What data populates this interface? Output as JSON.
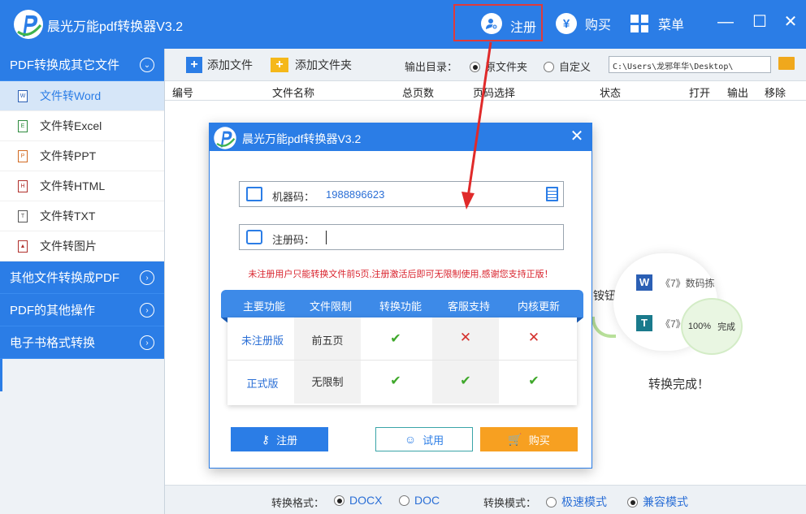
{
  "app": {
    "title": "晨光万能pdf转换器V3.2",
    "accent_color": "#2b7de6"
  },
  "titlebar": {
    "register_label": "注册",
    "register_icon": "user-add-icon",
    "buy_label": "购买",
    "buy_icon": "yen-icon",
    "menu_label": "菜单",
    "menu_icon": "grid-menu-icon",
    "minimize": "—",
    "maximize": "☐",
    "close": "✕"
  },
  "sidebar": {
    "group_main": "PDF转换成其它文件",
    "items": [
      {
        "label": "文件转Word",
        "icon": "W",
        "active": true
      },
      {
        "label": "文件转Excel",
        "icon": "E"
      },
      {
        "label": "文件转PPT",
        "icon": "P"
      },
      {
        "label": "文件转HTML",
        "icon": "H"
      },
      {
        "label": "文件转TXT",
        "icon": "T"
      },
      {
        "label": "文件转图片",
        "icon": "▲"
      }
    ],
    "groups": [
      {
        "label": "其他文件转换成PDF"
      },
      {
        "label": "PDF的其他操作"
      },
      {
        "label": "电子书格式转换"
      }
    ]
  },
  "toolbar": {
    "add_file": "添加文件",
    "add_folder": "添加文件夹",
    "output_dir_label": "输出目录：",
    "opt_source": "原文件夹",
    "opt_custom": "自定义",
    "output_path": "C:\\Users\\龙邪年华\\Desktop\\"
  },
  "table": {
    "headers": [
      "编号",
      "文件名称",
      "总页数",
      "页码选择",
      "状态",
      "打开",
      "输出",
      "移除"
    ]
  },
  "background": {
    "fragment": "铵钮",
    "file1": "《7》数码拣",
    "file2": "《7》",
    "progress_value": "100%",
    "progress_status": "完成",
    "done_text": "转换完成！"
  },
  "bottombar": {
    "format_label": "转换格式：",
    "format_docx": "DOCX",
    "format_doc": "DOC",
    "mode_label": "转换模式：",
    "mode_fast": "极速模式",
    "mode_compat": "兼容模式"
  },
  "dialog": {
    "title": "晨光万能pdf转换器V3.2",
    "close": "✕",
    "machine_label": "机器码：",
    "machine_code": "1988896623",
    "reg_label": "注册码：",
    "reg_value": "",
    "warning": "未注册用户只能转换文件前5页,注册激活后即可无限制使用,感谢您支持正版！",
    "compare": {
      "headers": [
        "主要功能",
        "文件限制",
        "转换功能",
        "客服支持",
        "内核更新"
      ],
      "rows": [
        {
          "version": "未注册版",
          "limit": "前五页",
          "convert": "✔",
          "support": "✕",
          "update": "✕"
        },
        {
          "version": "正式版",
          "limit": "无限制",
          "convert": "✔",
          "support": "✔",
          "update": "✔"
        }
      ]
    },
    "btn_register": "注册",
    "btn_trial": "试用",
    "btn_buy": "购买"
  }
}
